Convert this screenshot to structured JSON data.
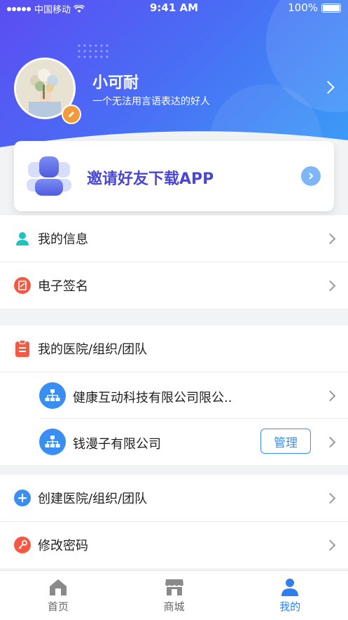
{
  "status_bar": {
    "carrier": "中国移动",
    "time": "9:41 AM",
    "battery": "100%"
  },
  "profile": {
    "name": "小可耐",
    "signature": "一个无法用言语表达的好人"
  },
  "invite": {
    "title": "邀请好友下载APP"
  },
  "menu_top": [
    {
      "label": "我的信息",
      "icon": "person-icon",
      "color": "#1cc6c0"
    },
    {
      "label": "电子签名",
      "icon": "signature-icon",
      "color": "#f25a44"
    }
  ],
  "org_section": {
    "header": "我的医院/组织/团队",
    "orgs": [
      {
        "name": "健康互动科技有限公司限公.."
      },
      {
        "name": "钱漫子有限公司",
        "action": "管理"
      }
    ]
  },
  "menu_bottom": [
    {
      "label": "创建医院/组织/团队",
      "icon": "plus-circle-icon",
      "color": "#3a8ef2"
    },
    {
      "label": "修改密码",
      "icon": "key-icon",
      "color": "#f25a44"
    }
  ],
  "tabbar": [
    {
      "label": "首页",
      "icon": "home-icon",
      "active": false
    },
    {
      "label": "商城",
      "icon": "shop-icon",
      "active": false
    },
    {
      "label": "我的",
      "icon": "user-icon",
      "active": true
    }
  ],
  "colors": {
    "accent": "#2f7ff0",
    "header_start": "#5b4df2",
    "header_end": "#3aa0f6"
  }
}
